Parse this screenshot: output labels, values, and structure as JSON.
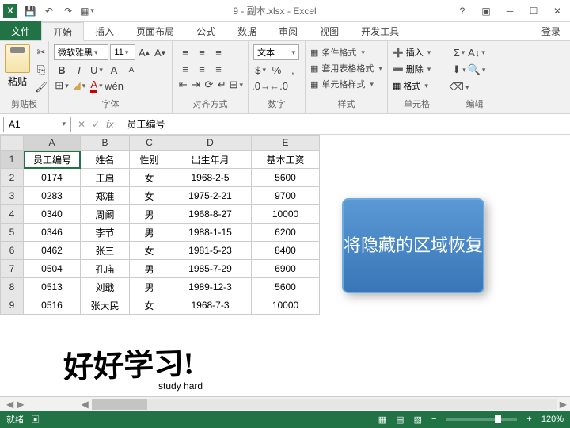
{
  "title": "9 - 副本.xlsx - Excel",
  "tabs": {
    "file": "文件",
    "home": "开始",
    "insert": "插入",
    "layout": "页面布局",
    "formulas": "公式",
    "data": "数据",
    "review": "审阅",
    "view": "视图",
    "dev": "开发工具",
    "login": "登录"
  },
  "ribbon": {
    "clipboard": {
      "label": "剪贴板",
      "paste": "粘贴"
    },
    "font": {
      "label": "字体",
      "name": "微软雅黑",
      "size": "11"
    },
    "align": {
      "label": "对齐方式"
    },
    "number": {
      "label": "数字",
      "format": "文本"
    },
    "styles": {
      "label": "样式",
      "cond": "条件格式",
      "table": "套用表格格式",
      "cell": "单元格样式"
    },
    "cells": {
      "label": "单元格",
      "insert": "插入",
      "delete": "删除",
      "format": "格式"
    },
    "editing": {
      "label": "编辑"
    }
  },
  "namebox": "A1",
  "formula": "员工编号",
  "cols": [
    "A",
    "B",
    "C",
    "D",
    "E"
  ],
  "chart_data": {
    "type": "table",
    "headers": [
      "员工编号",
      "姓名",
      "性别",
      "出生年月",
      "基本工资"
    ],
    "rows": [
      [
        "0174",
        "王启",
        "女",
        "1968-2-5",
        "5600"
      ],
      [
        "0283",
        "郑准",
        "女",
        "1975-2-21",
        "9700"
      ],
      [
        "0340",
        "周阚",
        "男",
        "1968-8-27",
        "10000"
      ],
      [
        "0346",
        "李节",
        "男",
        "1988-1-15",
        "6200"
      ],
      [
        "0462",
        "张三",
        "女",
        "1981-5-23",
        "8400"
      ],
      [
        "0504",
        "孔庙",
        "男",
        "1985-7-29",
        "6900"
      ],
      [
        "0513",
        "刘戢",
        "男",
        "1989-12-3",
        "5600"
      ],
      [
        "0516",
        "张大民",
        "女",
        "1968-7-3",
        "10000"
      ]
    ]
  },
  "callout": "将隐藏的区域恢复",
  "study": {
    "main": "好好学习!",
    "sub": "study hard"
  },
  "status": {
    "ready": "就绪",
    "zoom": "120%"
  }
}
